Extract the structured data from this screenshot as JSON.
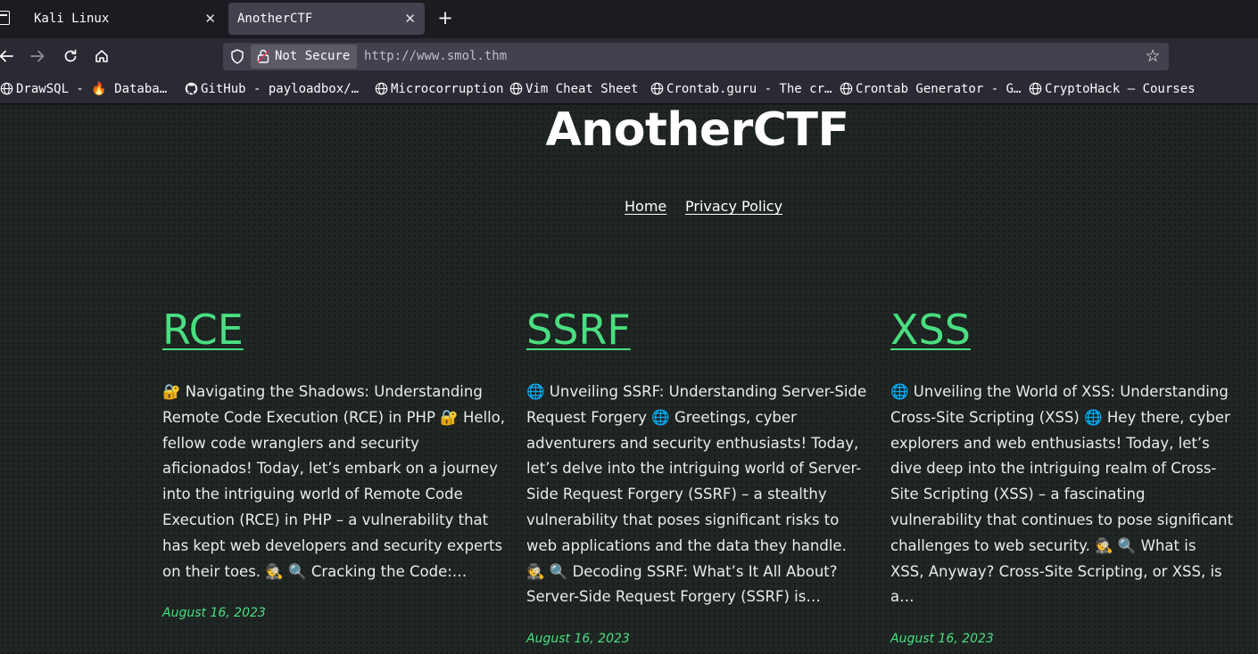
{
  "browser": {
    "tabs": [
      {
        "label": "Kali Linux"
      },
      {
        "label": "AnotherCTF"
      }
    ],
    "close_glyph": "✕",
    "new_tab_glyph": "+",
    "security_label": "Not Secure",
    "url": "http://www.smol.thm",
    "bookmarks": [
      {
        "label": "DrawSQL - 🔥 Databa…",
        "icon": "globe-icon"
      },
      {
        "label": "GitHub - payloadbox/…",
        "icon": "github-icon"
      },
      {
        "label": "Microcorruption",
        "icon": "globe-icon"
      },
      {
        "label": "Vim Cheat Sheet",
        "icon": "globe-icon"
      },
      {
        "label": "Crontab.guru - The cr…",
        "icon": "globe-icon"
      },
      {
        "label": "Crontab Generator - G…",
        "icon": "globe-icon"
      },
      {
        "label": "CryptoHack – Courses",
        "icon": "globe-icon"
      }
    ]
  },
  "site": {
    "title": "AnotherCTF",
    "nav": {
      "home": "Home",
      "privacy": "Privacy Policy"
    },
    "accent_color": "#4ade80"
  },
  "posts": [
    {
      "title": "RCE",
      "excerpt": "🔐 Navigating the Shadows: Understanding Remote Code Execution (RCE) in PHP 🔐 Hello, fellow code wranglers and security aficionados! Today, let’s embark on a journey into the intriguing world of Remote Code Execution (RCE) in PHP – a vulnerability that has kept web developers and security experts on their toes. 🕵 🔍 Cracking the Code:…",
      "date": "August 16, 2023"
    },
    {
      "title": "SSRF",
      "excerpt": "🌐 Unveiling SSRF: Understanding Server-Side Request Forgery 🌐 Greetings, cyber adventurers and security enthusiasts! Today, let’s delve into the intriguing world of Server-Side Request Forgery (SSRF) – a stealthy vulnerability that poses significant risks to web applications and the data they handle. 🕵 🔍 Decoding SSRF: What’s It All About? Server-Side Request Forgery (SSRF) is…",
      "date": "August 16, 2023"
    },
    {
      "title": "XSS",
      "excerpt": "🌐 Unveiling the World of XSS: Understanding Cross-Site Scripting (XSS) 🌐 Hey there, cyber explorers and web enthusiasts! Today, let’s dive deep into the intriguing realm of Cross-Site Scripting (XSS) – a fascinating vulnerability that continues to pose significant challenges to web security. 🕵 🔍 What is XSS, Anyway? Cross-Site Scripting, or XSS, is a…",
      "date": "August 16, 2023"
    }
  ]
}
